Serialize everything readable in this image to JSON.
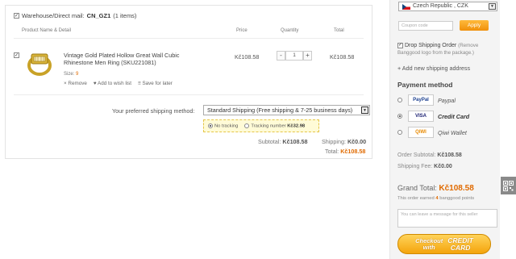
{
  "warehouse": {
    "checked": true,
    "label": "Warehouse/Direct mail:",
    "code": "CN_GZ1",
    "count": "(1 items)"
  },
  "columns": {
    "product": "Product Name & Detail",
    "price": "Price",
    "quantity": "Quantity",
    "total": "Total"
  },
  "product": {
    "checked": true,
    "name": "Vintage Gold Plated Hollow Great Wall Cubic Rhinestone Men Ring (SKU221081)",
    "size_label": "Size:",
    "size_value": "9",
    "remove": "× Remove",
    "wishlist": "♥ Add to wish list",
    "save_later": "≡ Save for later",
    "price": "Kč108.58",
    "qty_minus": "-",
    "qty_value": "1",
    "qty_plus": "+",
    "total": "Kč108.58"
  },
  "shipping": {
    "label": "Your preferred shipping method:",
    "selected": "Standard Shipping (Free shipping & 7-25 business days)",
    "no_tracking": "No tracking",
    "tracking_label": "Tracking number",
    "tracking_price": "Kč32.98",
    "selected_option": "no_tracking"
  },
  "summary": {
    "subtotal_label": "Subtotal:",
    "subtotal": "Kč108.58",
    "shipping_label": "Shipping:",
    "shipping": "Kč0.00",
    "total_label": "Total:",
    "total": "Kč108.58"
  },
  "sidebar": {
    "country": "Czech Republic , CZK",
    "coupon_placeholder": "Coupon code",
    "apply": "Apply",
    "drop_ship_label": "Drop Shipping Order",
    "drop_ship_note": "(Remove Banggood logo from the package.)",
    "drop_ship_checked": true,
    "add_address": "+ Add new shipping address",
    "payment_title": "Payment method",
    "payments": [
      {
        "logo": "PayPal",
        "label": "Paypal",
        "selected": false
      },
      {
        "logo": "VISA",
        "label": "Credit Card",
        "selected": true
      },
      {
        "logo": "QIWI",
        "label": "Qiwi Wallet",
        "selected": false
      }
    ],
    "order_subtotal_label": "Order Subtotal:",
    "order_subtotal": "Kč108.58",
    "shipping_fee_label": "Shipping Fee:",
    "shipping_fee": "Kč0.00",
    "grand_total_label": "Grand Total:",
    "grand_total": "Kč108.58",
    "earn_prefix": "This order earned",
    "earn_points": "4",
    "earn_suffix": "banggood points",
    "message_placeholder": "You can leave a message for this seller",
    "checkout_left1": "Checkout",
    "checkout_left2": "with",
    "checkout_right1": "CREDIT",
    "checkout_right2": "CARD"
  },
  "colors": {
    "accent": "#e06a00",
    "button": "#f4a40c",
    "tracking_bg": "#fffbd7"
  }
}
